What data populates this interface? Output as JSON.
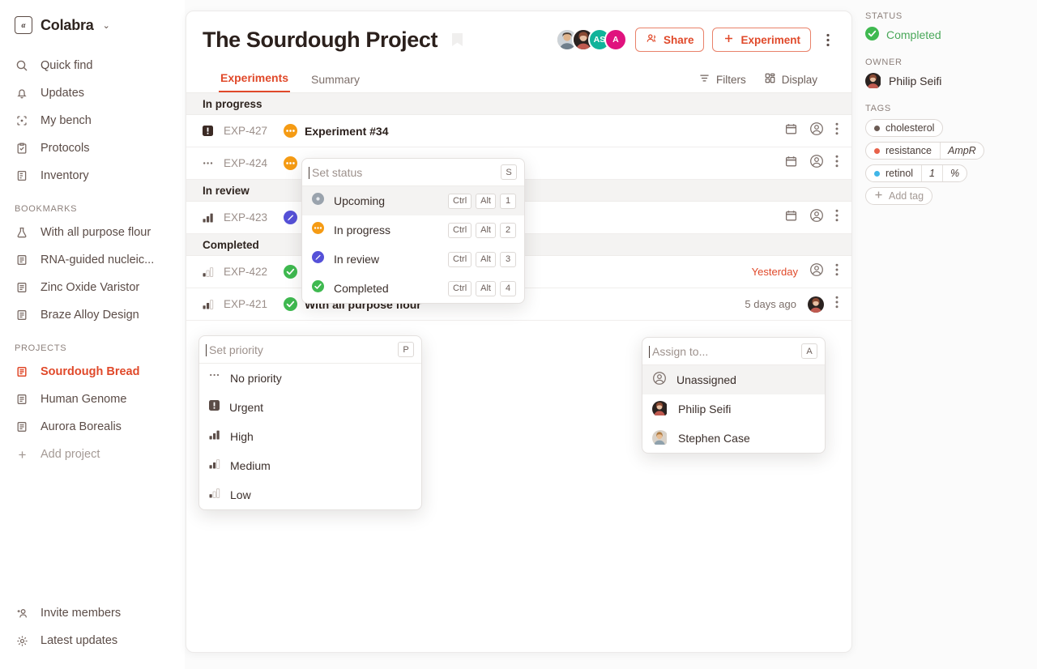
{
  "brand": {
    "logo_text": "α",
    "name": "Colabra",
    "caret": "⌄"
  },
  "sidebar": {
    "nav": [
      {
        "label": "Quick find",
        "icon": "search-icon"
      },
      {
        "label": "Updates",
        "icon": "bell-icon"
      },
      {
        "label": "My bench",
        "icon": "bench-icon"
      },
      {
        "label": "Protocols",
        "icon": "clipboard-check-icon"
      },
      {
        "label": "Inventory",
        "icon": "inventory-icon"
      }
    ],
    "bookmarks_label": "BOOKMARKS",
    "bookmarks": [
      {
        "label": "With all purpose flour",
        "icon": "flask-icon"
      },
      {
        "label": "RNA-guided nucleic...",
        "icon": "document-icon"
      },
      {
        "label": "Zinc Oxide Varistor",
        "icon": "document-icon"
      },
      {
        "label": "Braze Alloy Design",
        "icon": "document-icon"
      }
    ],
    "projects_label": "PROJECTS",
    "projects": [
      {
        "label": "Sourdough Bread",
        "icon": "document-icon",
        "active": true
      },
      {
        "label": "Human Genome",
        "icon": "document-icon",
        "active": false
      },
      {
        "label": "Aurora Borealis",
        "icon": "document-icon",
        "active": false
      }
    ],
    "add_project": {
      "label": "Add project",
      "icon": "plus-icon"
    },
    "bottom": [
      {
        "label": "Invite members",
        "icon": "invite-icon"
      },
      {
        "label": "Latest updates",
        "icon": "sparkle-icon"
      }
    ]
  },
  "header": {
    "title": "The Sourdough Project",
    "bookmark_icon": "bookmark-icon",
    "avatars": [
      {
        "type": "photo",
        "tone": "#c9a98c"
      },
      {
        "type": "photo",
        "tone": "#b2806d"
      },
      {
        "type": "initials",
        "initials": "AS",
        "color": "#12b39a"
      },
      {
        "type": "initials",
        "initials": "A",
        "color": "#e0127e"
      }
    ],
    "share_label": "Share",
    "share_icon": "share-people-icon",
    "experiment_label": "Experiment",
    "experiment_icon": "plus-icon",
    "more_icon": "kebab-icon",
    "accent": "#e0492a"
  },
  "tabs": [
    {
      "label": "Experiments",
      "active": true
    },
    {
      "label": "Summary",
      "active": false
    }
  ],
  "tools": [
    {
      "label": "Filters",
      "icon": "filter-icon"
    },
    {
      "label": "Display",
      "icon": "layout-icon"
    }
  ],
  "list": [
    {
      "group": "In progress",
      "rows": [
        {
          "code": "EXP-427",
          "priority": "urgent",
          "status": "progress",
          "name": "Experiment #34",
          "date": "",
          "date_accent": false,
          "calendar_icon": "calendar-icon",
          "assignee_icon": "user-circle-icon",
          "more_icon": "kebab-icon"
        },
        {
          "code": "EXP-424",
          "priority": "none",
          "status": "progress",
          "name": "",
          "date": "",
          "date_accent": false,
          "calendar_icon": "calendar-icon",
          "assignee_icon": "user-circle-icon",
          "more_icon": "kebab-icon"
        }
      ]
    },
    {
      "group": "In review",
      "rows": [
        {
          "code": "EXP-423",
          "priority": "high",
          "status": "review",
          "name": "",
          "date": "",
          "date_accent": false,
          "calendar_icon": "calendar-icon",
          "assignee_icon": "user-circle-icon",
          "more_icon": "kebab-icon"
        }
      ]
    },
    {
      "group": "Completed",
      "rows": [
        {
          "code": "EXP-422",
          "priority": "low",
          "status": "completed",
          "name": "",
          "date": "Yesterday",
          "date_accent": true,
          "calendar_icon": "",
          "assignee_icon": "user-circle-icon",
          "more_icon": "kebab-icon"
        },
        {
          "code": "EXP-421",
          "priority": "medium",
          "status": "completed",
          "name": "With all purpose flour",
          "date": "5 days ago",
          "date_accent": false,
          "calendar_icon": "",
          "assignee_icon": "avatar-photo",
          "more_icon": "kebab-icon"
        }
      ]
    }
  ],
  "status_popup": {
    "placeholder": "Set status",
    "shortcut": "S",
    "options": [
      {
        "label": "Upcoming",
        "status": "upcoming",
        "keys": [
          "Ctrl",
          "Alt",
          "1"
        ],
        "selected": true
      },
      {
        "label": "In progress",
        "status": "progress",
        "keys": [
          "Ctrl",
          "Alt",
          "2"
        ],
        "selected": false
      },
      {
        "label": "In review",
        "status": "review",
        "keys": [
          "Ctrl",
          "Alt",
          "3"
        ],
        "selected": false
      },
      {
        "label": "Completed",
        "status": "completed",
        "keys": [
          "Ctrl",
          "Alt",
          "4"
        ],
        "selected": false
      }
    ]
  },
  "priority_popup": {
    "placeholder": "Set priority",
    "shortcut": "P",
    "options": [
      {
        "label": "No priority",
        "priority": "none"
      },
      {
        "label": "Urgent",
        "priority": "urgent"
      },
      {
        "label": "High",
        "priority": "high"
      },
      {
        "label": "Medium",
        "priority": "medium"
      },
      {
        "label": "Low",
        "priority": "low"
      }
    ]
  },
  "assign_popup": {
    "placeholder": "Assign to...",
    "shortcut": "A",
    "options": [
      {
        "label": "Unassigned",
        "avatar": "user-circle-icon",
        "selected": true
      },
      {
        "label": "Philip Seifi",
        "avatar": "photo-dark",
        "selected": false
      },
      {
        "label": "Stephen Case",
        "avatar": "photo-light",
        "selected": false
      }
    ]
  },
  "details": {
    "status_label": "STATUS",
    "status_value": "Completed",
    "status_color": "#3fb950",
    "owner_label": "OWNER",
    "owner_value": "Philip Seifi",
    "tags_label": "TAGS",
    "tags": [
      {
        "name": "cholesterol",
        "color": "#6b5b54",
        "segments": []
      },
      {
        "name": "resistance",
        "color": "#e8624a",
        "segments": [
          "AmpR"
        ]
      },
      {
        "name": "retinol",
        "color": "#3fb6e8",
        "segments": [
          "1",
          "%"
        ]
      }
    ],
    "add_tag": "Add tag"
  }
}
